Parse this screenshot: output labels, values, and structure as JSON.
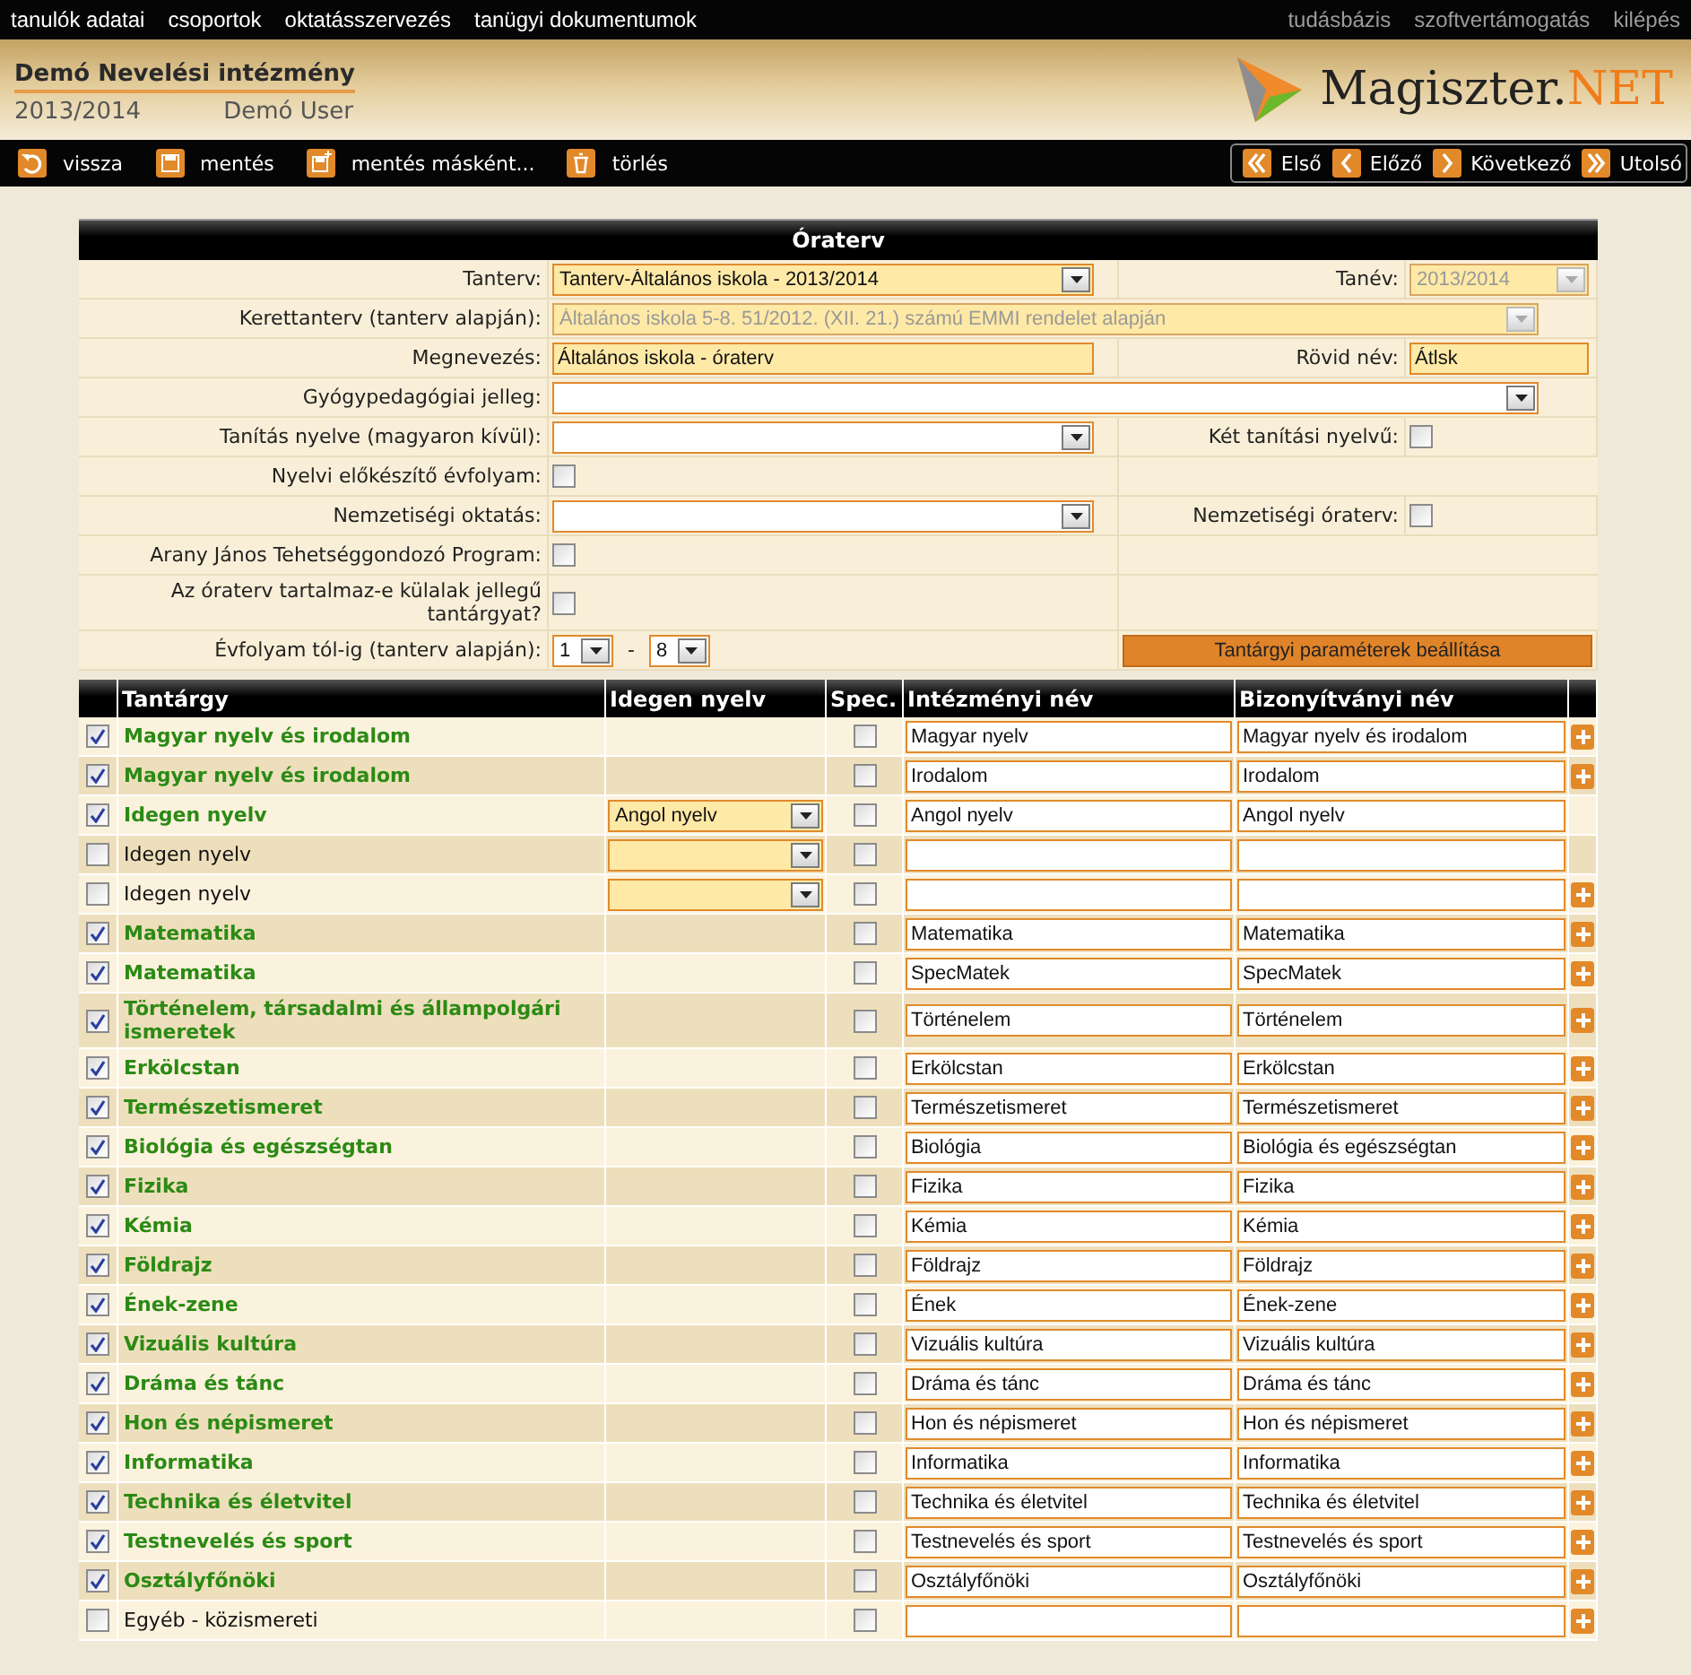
{
  "top_nav": {
    "left": [
      "tanulók adatai",
      "csoportok",
      "oktatásszervezés",
      "tanügyi dokumentumok"
    ],
    "right": [
      "tudásbázis",
      "szoftvertámogatás",
      "kilépés"
    ]
  },
  "header": {
    "institution": "Demó Nevelési intézmény",
    "school_year": "2013/2014",
    "user": "Demó User",
    "logo": {
      "text": "Magiszter.",
      "accent": "NET"
    }
  },
  "toolbar": {
    "actions": [
      {
        "kind": "back",
        "label": "vissza"
      },
      {
        "kind": "save",
        "label": "mentés"
      },
      {
        "kind": "save_as",
        "label": "mentés másként..."
      },
      {
        "kind": "delete",
        "label": "törlés"
      }
    ],
    "pager": [
      {
        "kind": "first",
        "label": "Első"
      },
      {
        "kind": "prev",
        "label": "Előző"
      },
      {
        "kind": "next",
        "label": "Következő"
      },
      {
        "kind": "last",
        "label": "Utolsó"
      }
    ]
  },
  "form": {
    "title": "Óraterv",
    "rows": [
      {
        "label": "Tanterv:",
        "field": {
          "kind": "select",
          "value": "Tanterv-Általános iskola - 2013/2014",
          "required": true,
          "disabled": false
        },
        "right": {
          "label": "Tanév:",
          "field": {
            "kind": "select",
            "value": "2013/2014",
            "required": true,
            "disabled": true
          }
        }
      },
      {
        "label": "Kerettanterv (tanterv alapján):",
        "field": {
          "kind": "select",
          "value": "Általános iskola 5-8. 51/2012. (XII. 21.) számú EMMI rendelet alapján",
          "required": true,
          "disabled": true
        }
      },
      {
        "label": "Megnevezés:",
        "field": {
          "kind": "text",
          "value": "Általános iskola - óraterv",
          "required": true
        },
        "right": {
          "label": "Rövid név:",
          "field": {
            "kind": "text",
            "value": "Átlsk",
            "required": true
          }
        }
      },
      {
        "label": "Gyógypedagógiai jelleg:",
        "field": {
          "kind": "select",
          "required": false,
          "disabled": false
        }
      },
      {
        "label": "Tanítás nyelve (magyaron kívül):",
        "field": {
          "kind": "select",
          "required": false,
          "disabled": false
        },
        "right": {
          "label": "Két tanítási nyelvű:",
          "field": {
            "kind": "checkbox",
            "checked": false
          }
        }
      },
      {
        "label": "Nyelvi előkészítő évfolyam:",
        "field": {
          "kind": "checkbox",
          "checked": false
        }
      },
      {
        "label": "Nemzetiségi oktatás:",
        "field": {
          "kind": "select",
          "required": false,
          "disabled": false
        },
        "right": {
          "label": "Nemzetiségi óraterv:",
          "field": {
            "kind": "checkbox",
            "checked": false
          }
        }
      },
      {
        "label": "Arany János Tehetséggondozó Program:",
        "field": {
          "kind": "checkbox",
          "checked": false
        }
      },
      {
        "label": "Az óraterv tartalmaz-e külalak jellegű tantárgyat?",
        "field": {
          "kind": "checkbox",
          "checked": false
        }
      },
      {
        "label": "Évfolyam tól-ig (tanterv alapján):",
        "field": {
          "kind": "range",
          "from": "1",
          "separator": "-",
          "to": "8"
        },
        "right": {
          "button": "Tantárgyi paraméterek beállítása"
        }
      }
    ]
  },
  "table": {
    "columns": [
      "Tantárgy",
      "Idegen nyelv",
      "Spec.",
      "Intézményi név",
      "Bizonyítványi név"
    ],
    "rows": [
      {
        "checked": true,
        "subject": "Magyar nyelv és irodalom",
        "language_select": false,
        "spec": false,
        "institutional": "Magyar nyelv",
        "certificate": "Magyar nyelv és irodalom",
        "can_add": true
      },
      {
        "checked": true,
        "subject": "Magyar nyelv és irodalom",
        "language_select": false,
        "spec": false,
        "institutional": "Irodalom",
        "certificate": "Irodalom",
        "can_add": true
      },
      {
        "checked": true,
        "subject": "Idegen nyelv",
        "language_select": true,
        "language": "Angol nyelv",
        "spec": false,
        "institutional": "Angol nyelv",
        "certificate": "Angol nyelv",
        "can_add": false
      },
      {
        "checked": false,
        "subject": "Idegen nyelv",
        "language_select": true,
        "spec": false,
        "can_add": false
      },
      {
        "checked": false,
        "subject": "Idegen nyelv",
        "language_select": true,
        "spec": false,
        "can_add": true
      },
      {
        "checked": true,
        "subject": "Matematika",
        "language_select": false,
        "spec": false,
        "institutional": "Matematika",
        "certificate": "Matematika",
        "can_add": true
      },
      {
        "checked": true,
        "subject": "Matematika",
        "language_select": false,
        "spec": false,
        "institutional": "SpecMatek",
        "certificate": "SpecMatek",
        "can_add": true
      },
      {
        "checked": true,
        "subject": "Történelem, társadalmi és állampolgári ismeretek",
        "language_select": false,
        "spec": false,
        "institutional": "Történelem",
        "certificate": "Történelem",
        "can_add": true
      },
      {
        "checked": true,
        "subject": "Erkölcstan",
        "language_select": false,
        "spec": false,
        "institutional": "Erkölcstan",
        "certificate": "Erkölcstan",
        "can_add": true
      },
      {
        "checked": true,
        "subject": "Természetismeret",
        "language_select": false,
        "spec": false,
        "institutional": "Természetismeret",
        "certificate": "Természetismeret",
        "can_add": true
      },
      {
        "checked": true,
        "subject": "Biológia és egészségtan",
        "language_select": false,
        "spec": false,
        "institutional": "Biológia",
        "certificate": "Biológia és egészségtan",
        "can_add": true
      },
      {
        "checked": true,
        "subject": "Fizika",
        "language_select": false,
        "spec": false,
        "institutional": "Fizika",
        "certificate": "Fizika",
        "can_add": true
      },
      {
        "checked": true,
        "subject": "Kémia",
        "language_select": false,
        "spec": false,
        "institutional": "Kémia",
        "certificate": "Kémia",
        "can_add": true
      },
      {
        "checked": true,
        "subject": "Földrajz",
        "language_select": false,
        "spec": false,
        "institutional": "Földrajz",
        "certificate": "Földrajz",
        "can_add": true
      },
      {
        "checked": true,
        "subject": "Ének-zene",
        "language_select": false,
        "spec": false,
        "institutional": "Ének",
        "certificate": "Ének-zene",
        "can_add": true
      },
      {
        "checked": true,
        "subject": "Vizuális kultúra",
        "language_select": false,
        "spec": false,
        "institutional": "Vizuális kultúra",
        "certificate": "Vizuális kultúra",
        "can_add": true
      },
      {
        "checked": true,
        "subject": "Dráma és tánc",
        "language_select": false,
        "spec": false,
        "institutional": "Dráma és tánc",
        "certificate": "Dráma és tánc",
        "can_add": true
      },
      {
        "checked": true,
        "subject": "Hon és népismeret",
        "language_select": false,
        "spec": false,
        "institutional": "Hon és népismeret",
        "certificate": "Hon és népismeret",
        "can_add": true
      },
      {
        "checked": true,
        "subject": "Informatika",
        "language_select": false,
        "spec": false,
        "institutional": "Informatika",
        "certificate": "Informatika",
        "can_add": true
      },
      {
        "checked": true,
        "subject": "Technika és életvitel",
        "language_select": false,
        "spec": false,
        "institutional": "Technika és életvitel",
        "certificate": "Technika és életvitel",
        "can_add": true
      },
      {
        "checked": true,
        "subject": "Testnevelés és sport",
        "language_select": false,
        "spec": false,
        "institutional": "Testnevelés és sport",
        "certificate": "Testnevelés és sport",
        "can_add": true
      },
      {
        "checked": true,
        "subject": "Osztályfőnöki",
        "language_select": false,
        "spec": false,
        "institutional": "Osztályfőnöki",
        "certificate": "Osztályfőnöki",
        "can_add": true
      },
      {
        "checked": false,
        "subject": "Egyéb - közismereti",
        "language_select": false,
        "spec": false,
        "can_add": true
      }
    ]
  }
}
